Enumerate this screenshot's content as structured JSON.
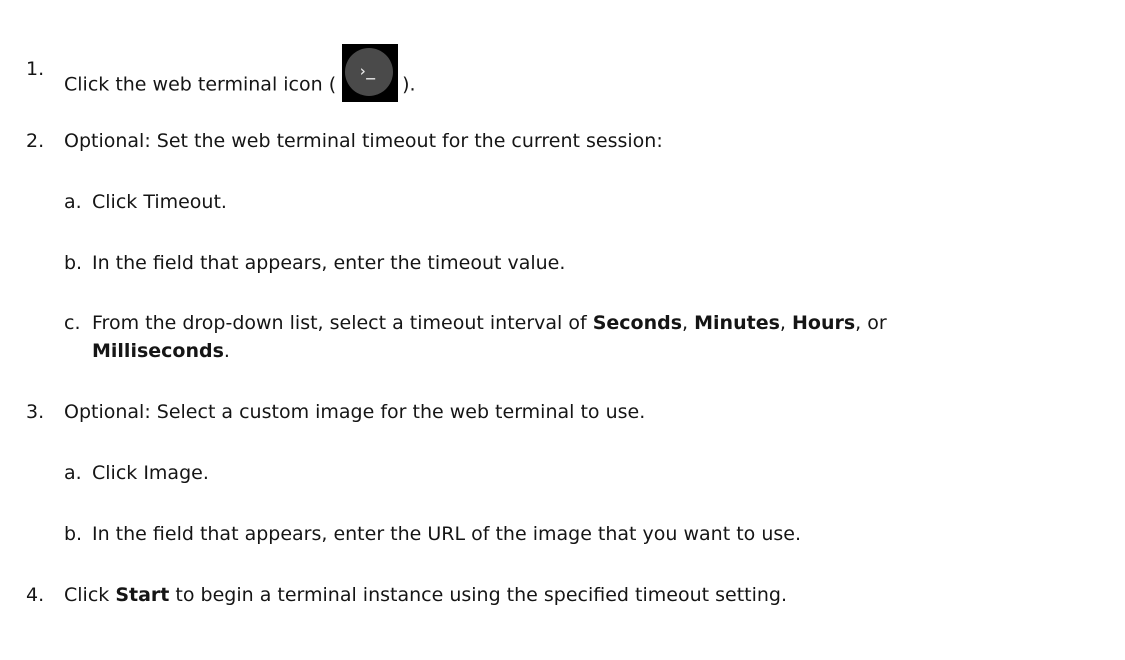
{
  "steps": {
    "s1": {
      "num": "1.",
      "text_before": "Click the web terminal icon (",
      "text_after": ").",
      "icon_glyph": "›_"
    },
    "s2": {
      "num": "2.",
      "text": "Optional: Set the web terminal timeout for the current session:",
      "a": {
        "num": "a.",
        "text": "Click Timeout."
      },
      "b": {
        "num": "b.",
        "text": "In the field that appears, enter the timeout value."
      },
      "c": {
        "num": "c.",
        "text_1": "From the drop-down list, select a timeout interval of ",
        "seconds": "Seconds",
        "sep_1": ", ",
        "minutes": "Minutes",
        "sep_2": ", ",
        "hours": "Hours",
        "sep_3": ", or",
        "milliseconds": "Milliseconds",
        "end": "."
      }
    },
    "s3": {
      "num": "3.",
      "text": "Optional: Select a custom image for the web terminal to use.",
      "a": {
        "num": "a.",
        "text": "Click Image."
      },
      "b": {
        "num": "b.",
        "text": "In the field that appears, enter the URL of the image that you want to use."
      }
    },
    "s4": {
      "num": "4.",
      "text_1": "Click ",
      "start": "Start",
      "text_2": " to begin a terminal instance using the specified timeout setting."
    }
  }
}
